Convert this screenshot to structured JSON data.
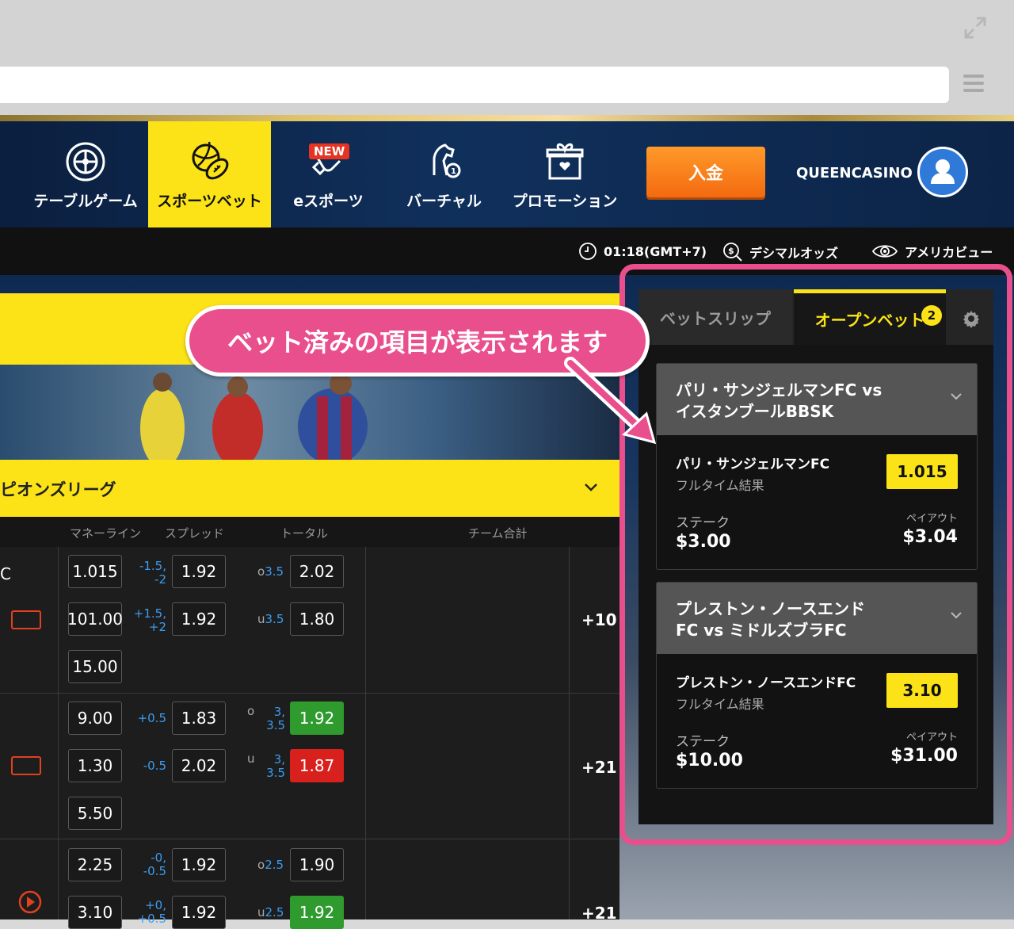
{
  "nav": {
    "items": [
      {
        "label": "テーブルゲーム"
      },
      {
        "label": "スポーツベット"
      },
      {
        "label": "eスポーツ",
        "badge": "NEW"
      },
      {
        "label": "バーチャル"
      },
      {
        "label": "プロモーション"
      }
    ],
    "deposit_label": "入金",
    "brand": "QUEENCASINO"
  },
  "subbar": {
    "time": "01:18(GMT+7)",
    "odds_format": "デシマルオッズ",
    "view": "アメリカビュー"
  },
  "league": {
    "title": "ピオンズリーグ"
  },
  "table": {
    "headers": {
      "moneyline": "マネーライン",
      "spread": "スプレッド",
      "total": "トータル",
      "team_total": "チーム合計"
    },
    "first_row_label": "C",
    "rows": [
      {
        "moneyline": [
          "1.015",
          "101.00",
          "15.00"
        ],
        "spread": [
          {
            "hcap": "-1.5,\n-2",
            "odd": "1.92"
          },
          {
            "hcap": "+1.5,\n+2",
            "odd": "1.92"
          }
        ],
        "total": [
          {
            "side": "o",
            "line": "3.5",
            "odd": "2.02"
          },
          {
            "side": "u",
            "line": "3.5",
            "odd": "1.80"
          }
        ],
        "more": "+10"
      },
      {
        "moneyline": [
          "9.00",
          "1.30",
          "5.50"
        ],
        "spread": [
          {
            "hcap": "+0.5",
            "odd": "1.83"
          },
          {
            "hcap": "-0.5",
            "odd": "2.02"
          }
        ],
        "total": [
          {
            "side": "o",
            "line": "3,\n3.5",
            "odd": "1.92"
          },
          {
            "side": "u",
            "line": "3,\n3.5",
            "odd": "1.87"
          }
        ],
        "more": "+21"
      },
      {
        "moneyline": [
          "2.25",
          "3.10"
        ],
        "spread": [
          {
            "hcap": "-0,\n-0.5",
            "odd": "1.92"
          },
          {
            "hcap": "+0,\n+0.5",
            "odd": "1.92"
          }
        ],
        "total": [
          {
            "side": "o",
            "line": "2.5",
            "odd": "1.90"
          },
          {
            "side": "u",
            "line": "2.5",
            "odd": "1.92"
          }
        ],
        "more": "+21"
      }
    ]
  },
  "betslip": {
    "tab_betslip": "ベットスリップ",
    "tab_open": "オープンベット",
    "open_count": "2",
    "bets": [
      {
        "match": "パリ・サンジェルマンFC vs\nイスタンブールBBSK",
        "selection": "パリ・サンジェルマンFC",
        "market": "フルタイム結果",
        "price": "1.015",
        "stake_label": "ステーク",
        "stake": "$3.00",
        "payout_label": "ペイアウト",
        "payout": "$3.04"
      },
      {
        "match": "プレストン・ノースエンド\nFC vs ミドルズブラFC",
        "selection": "プレストン・ノースエンドFC",
        "market": "フルタイム結果",
        "price": "3.10",
        "stake_label": "ステーク",
        "stake": "$10.00",
        "payout_label": "ペイアウト",
        "payout": "$31.00"
      }
    ]
  },
  "callout": {
    "text": "ベット済みの項目が表示されます"
  },
  "colors": {
    "accent_yellow": "#fbe317",
    "pink": "#e94f8d",
    "header_navy": "#0b1f3f",
    "deposit_orange": "#f36a10",
    "odds_blue": "#3c9cf0",
    "up_green": "#2f9b2f",
    "down_red": "#d8201d"
  }
}
